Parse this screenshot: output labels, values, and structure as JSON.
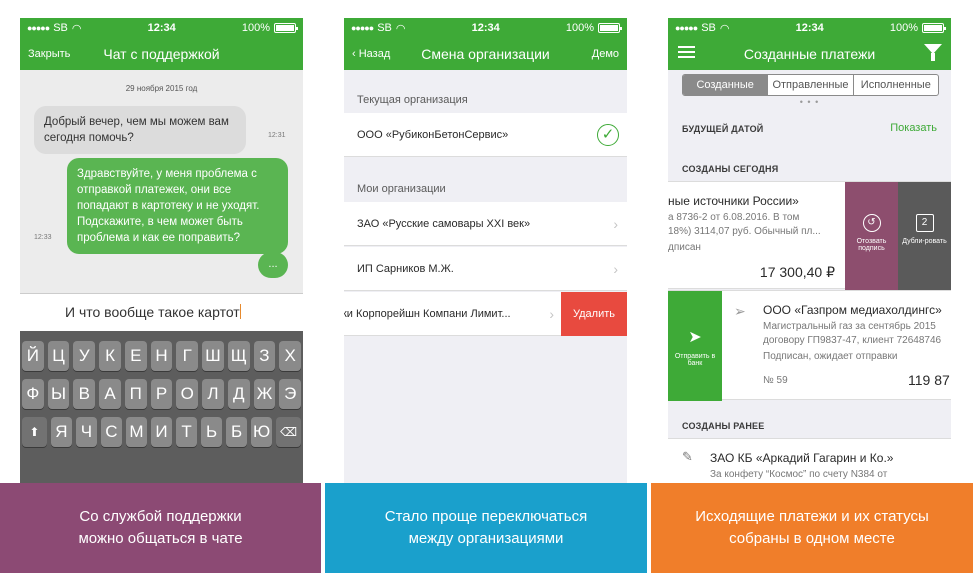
{
  "colors": {
    "green": "#3eaa37",
    "caption1": "#8c4a74",
    "caption2": "#1aa0cc",
    "caption3": "#f07e2a",
    "delete": "#e84a3f"
  },
  "status": {
    "carrier": "SB",
    "time": "12:34",
    "battery": "100%"
  },
  "chat": {
    "nav_left": "Закрыть",
    "title": "Чат с поддержкой",
    "date": "29 ноября 2015 год",
    "incoming": "Добрый вечер, чем мы можем вам сегодня помочь?",
    "incoming_time": "12:31",
    "outgoing": "Здравствуйте, у меня проблема с отправкой платежек, они все попадают в картотеку и не уходят. Подскажите, в чем может быть проблема и как ее поправить?",
    "outgoing_time": "12:33",
    "typing": "...",
    "input_text": "И что вообще такое картот",
    "keyboard": {
      "row1": [
        "Й",
        "Ц",
        "У",
        "К",
        "Е",
        "Н",
        "Г",
        "Ш",
        "Щ",
        "З",
        "Х"
      ],
      "row2": [
        "Ф",
        "Ы",
        "В",
        "А",
        "П",
        "Р",
        "О",
        "Л",
        "Д",
        "Ж",
        "Э"
      ],
      "row3": [
        "Я",
        "Ч",
        "С",
        "М",
        "И",
        "Т",
        "Ь",
        "Б",
        "Ю"
      ]
    }
  },
  "orgs": {
    "nav_left": "Назад",
    "title": "Смена организации",
    "nav_right": "Демо",
    "current_header": "Текущая организация",
    "current": "ООО «РубиконБетонСервис»",
    "mine_header": "Мои организации",
    "items": [
      "ЗАО «Русские самовары XXI век»",
      "ИП Сарников М.Ж.",
      "Джи Корпорейшн Компани Лимит..."
    ],
    "delete_label": "Удалить"
  },
  "payments": {
    "title": "Созданные платежи",
    "tabs": [
      "Созданные",
      "Отправленные",
      "Исполненные"
    ],
    "future_header": "БУДУЩЕЙ ДАТОЙ",
    "show_link": "Показать",
    "today_header": "СОЗДАНЫ СЕГОДНЯ",
    "card1": {
      "title": "ные источники России»",
      "line1": "а 8736-2 от 6.08.2016. В том",
      "line2": "18%) 3114,07 руб. Обычный пл...",
      "status": "дписан",
      "amount": "17 300,40 ₽"
    },
    "actions": {
      "recall": "Отозвать подпись",
      "duplicate": "Дубли-ровать",
      "send": "Отправить в банк"
    },
    "card2": {
      "org": "ООО «Газпром медиахолдингс»",
      "line1": "Магистральный газ за сентябрь 2015",
      "line2": "договору ГП9837-47, клиент 72648746",
      "status": "Подписан, ожидает отправки",
      "number": "№ 59",
      "amount": "119 87"
    },
    "earlier_header": "СОЗДАНЫ РАНЕЕ",
    "card3": {
      "org": "ЗАО КБ «Аркадий Гагарин и Ко.»",
      "line1": "За конфету “Космос” по счету N384 от"
    }
  },
  "captions": {
    "c1": [
      "Со службой поддержки",
      "можно общаться в чате"
    ],
    "c2": [
      "Стало проще переключаться",
      "между организациями"
    ],
    "c3": [
      "Исходящие платежи и их статусы",
      "собраны в одном месте"
    ]
  }
}
